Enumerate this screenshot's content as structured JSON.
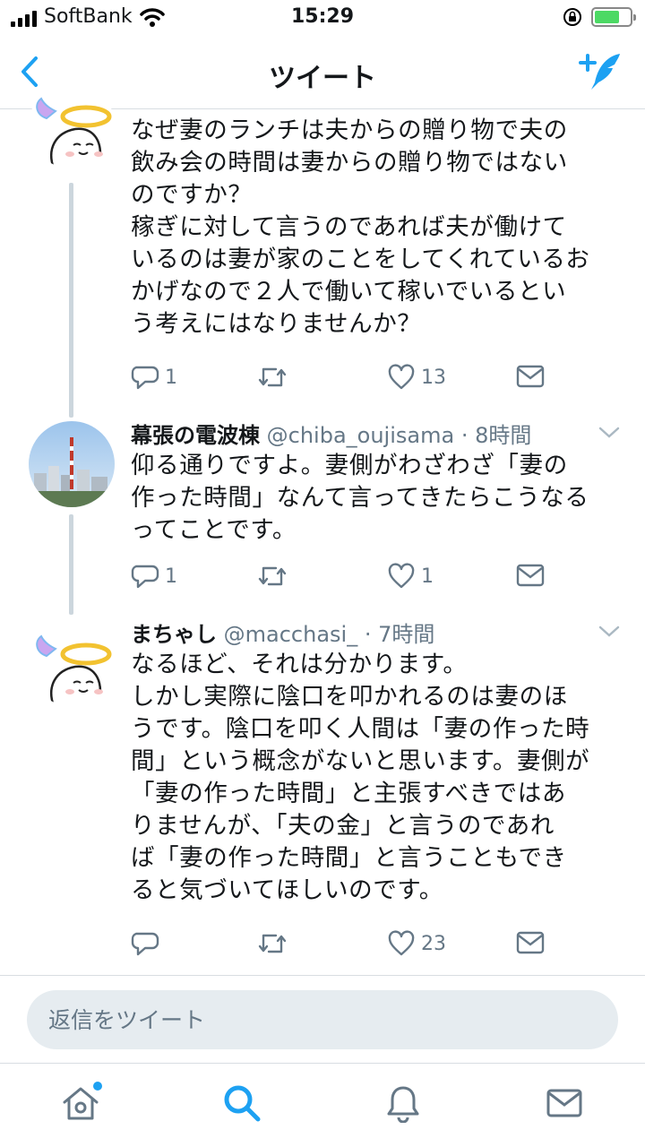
{
  "status_bar": {
    "carrier": "SoftBank",
    "time": "15:29",
    "battery_color": "#4cd964"
  },
  "nav": {
    "title": "ツイート",
    "back_icon": "chevron-left-icon",
    "compose_icon": "compose-tweet-icon",
    "accent": "#1da1f2"
  },
  "tweets": [
    {
      "text": "なぜ妻のランチは夫からの贈り物で夫の\n飲み会の時間は妻からの贈り物ではない\nのですか？\n稼ぎに対して言うのであれば夫が働けて\nいるのは妻が家のことをしてくれているお\nかげなので２人で働いて稼いでいるとい\nう考えにはなりませんか？",
      "replies": "1",
      "retweets": "",
      "likes": "13"
    },
    {
      "name": "幕張の電波棟",
      "handle_time": "@chiba_oujisama · 8時間",
      "text": "仰る通りですよ。妻側がわざわざ「妻の\n作った時間」なんて言ってきたらこうなる\nってことです。",
      "replies": "1",
      "retweets": "",
      "likes": "1"
    },
    {
      "name": "まちゃし",
      "handle_time": "@macchasi_ · 7時間",
      "text": "なるほど、それは分かります。\nしかし実際に陰口を叩かれるのは妻のほ\nうです。陰口を叩く人間は「妻の作った時\n間」という概念がないと思います。妻側が\n「妻の作った時間」と主張すべきではあ\nりませんが、「夫の金」と言うのであれ\nば「妻の作った時間」と言うこともでき\nると気づいてほしいのです。",
      "replies": "",
      "retweets": "",
      "likes": "23"
    }
  ],
  "reply": {
    "placeholder": "返信をツイート"
  },
  "tabs": [
    {
      "icon": "home-icon",
      "active": false
    },
    {
      "icon": "search-icon",
      "active": true
    },
    {
      "icon": "bell-icon",
      "active": false
    },
    {
      "icon": "mail-icon",
      "active": false
    }
  ]
}
